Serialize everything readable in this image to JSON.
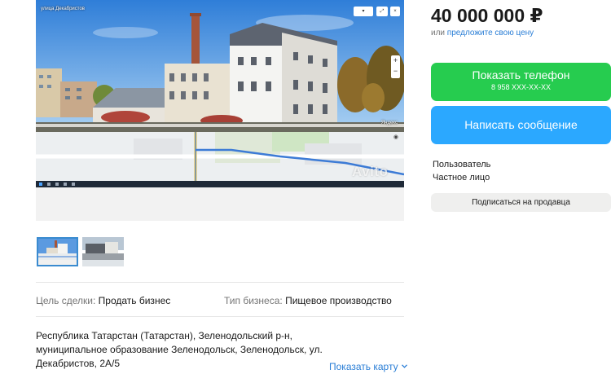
{
  "photo": {
    "street_label": "улица Декабристов",
    "watermark": "Avito",
    "map_provider": "Яндекс"
  },
  "listing": {
    "params": [
      {
        "key": "Цель сделки:",
        "value": "Продать бизнес"
      },
      {
        "key": "Тип бизнеса:",
        "value": "Пищевое производство"
      }
    ],
    "address_lines": [
      "Республика Татарстан (Татарстан), Зеленодольский р-н,",
      "муниципальное образование Зеленодольск, Зеленодольск, ул.",
      "Декабристов, 2А/5"
    ],
    "show_map": "Показать карту"
  },
  "sidebar": {
    "price": "40 000 000 ₽",
    "price_or": "или",
    "offer_price_link": "предложите свою цену",
    "phone_button": {
      "label": "Показать телефон",
      "number": "8 958 XXX-XX-XX"
    },
    "message_button": "Написать сообщение",
    "seller": {
      "role": "Пользователь",
      "type": "Частное лицо"
    },
    "subscribe_button": "Подписаться на продавца"
  },
  "colors": {
    "phone_button": "#26cc4f",
    "message_button": "#2ba8ff",
    "link": "#2a7ed6",
    "thumb_active_border": "#3a8bd0"
  },
  "icons": {
    "show_map_chevron": "chevron-down-icon",
    "zoom": [
      "plus-icon",
      "minus-icon"
    ]
  }
}
